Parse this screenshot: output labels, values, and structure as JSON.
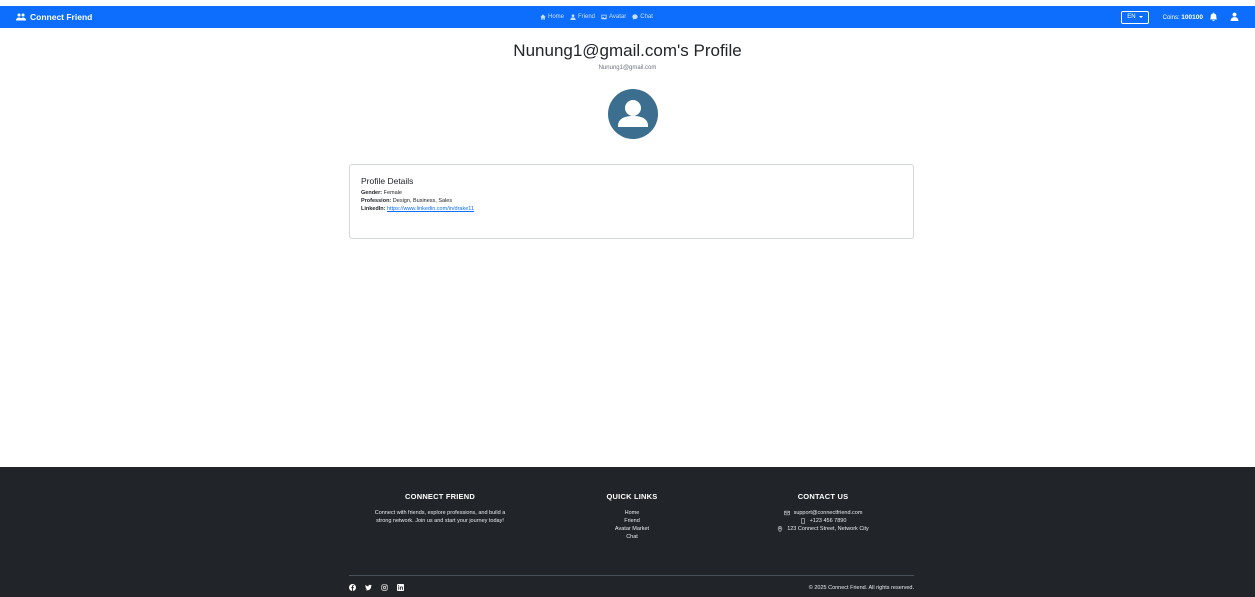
{
  "navbar": {
    "brand": "Connect Friend",
    "links": [
      {
        "label": "Home",
        "icon": "home-icon"
      },
      {
        "label": "Friend",
        "icon": "person-icon"
      },
      {
        "label": "Avatar",
        "icon": "image-icon"
      },
      {
        "label": "Chat",
        "icon": "chat-icon"
      }
    ],
    "language": "EN",
    "coins_label": "Coins:",
    "coins_value": "100100"
  },
  "profile": {
    "title": "Nunung1@gmail.com's Profile",
    "email": "Nunung1@gmail.com"
  },
  "details": {
    "heading": "Profile Details",
    "gender_label": "Gender:",
    "gender_value": "Female",
    "profession_label": "Profession:",
    "profession_value": "Design, Business, Sales",
    "linkedin_label": "LinkedIn:",
    "linkedin_value": "https://www.linkedin.com/in/drake11"
  },
  "footer": {
    "about_heading": "CONNECT FRIEND",
    "about_line1": "Connect with friends, explore professions, and build a",
    "about_line2": "strong network. Join us and start your journey today!",
    "links_heading": "QUICK LINKS",
    "links": [
      "Home",
      "Friend",
      "Avatar Market",
      "Chat"
    ],
    "contact_heading": "CONTACT US",
    "email": "support@connectfriend.com",
    "phone": "+123 456 7890",
    "address": "123 Connect Street, Network City",
    "copyright": "© 2025 Connect Friend. All rights reserved."
  },
  "colors": {
    "primary": "#0d6efd",
    "footer_bg": "#212529",
    "avatar_bg": "#3b6e8f"
  }
}
